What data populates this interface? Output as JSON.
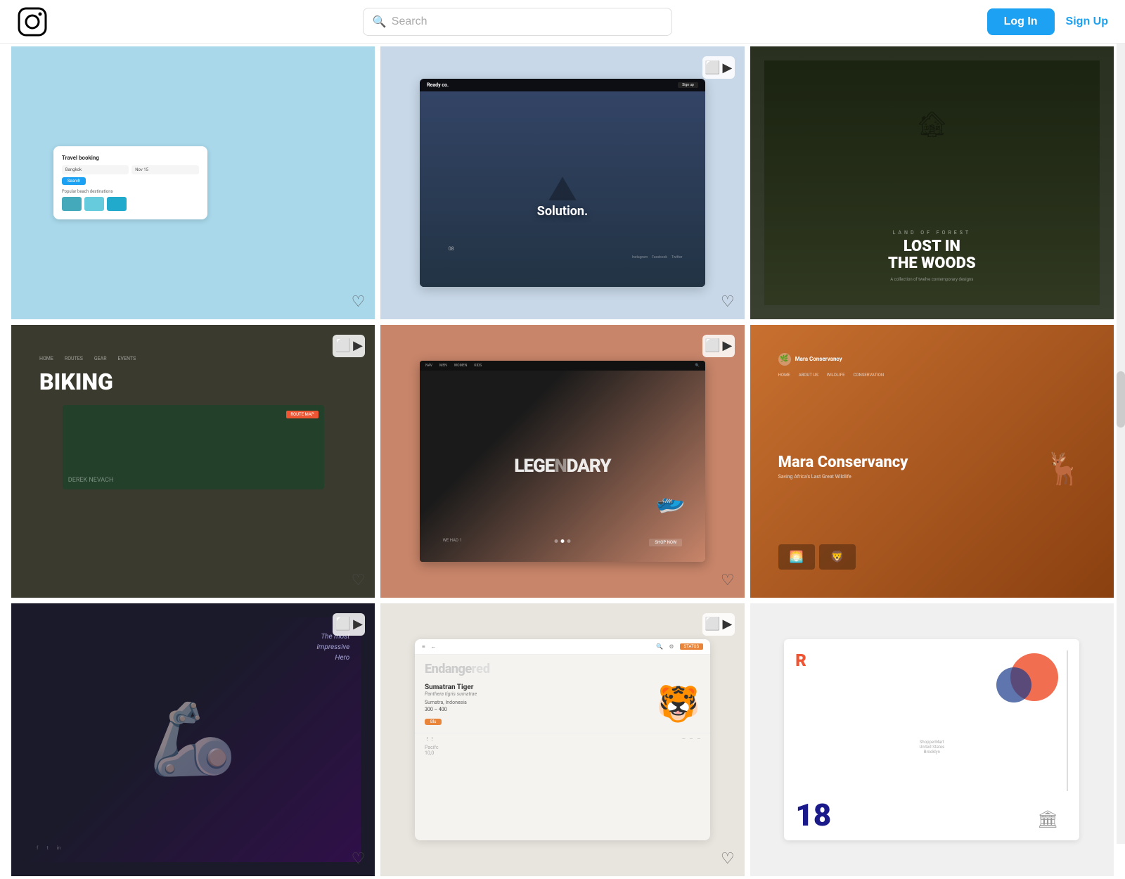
{
  "header": {
    "logo_alt": "Instagram logo",
    "search_placeholder": "Search",
    "login_label": "Log In",
    "signup_label": "Sign Up"
  },
  "gallery": {
    "items": [
      {
        "id": "travel",
        "type": "photo",
        "card_class": "card-travel",
        "has_heart": true,
        "row": 1,
        "col": 1,
        "alt": "Travel booking UI with beach destinations and teal ocean background"
      },
      {
        "id": "biking",
        "type": "multi",
        "card_class": "card-biking",
        "has_heart": true,
        "row": 1,
        "col": 2,
        "alt": "Biking website design with dark forest aerial view and bold typography"
      },
      {
        "id": "dark-movie",
        "type": "multi",
        "card_class": "card-dark",
        "has_heart": true,
        "row": 1,
        "col": 3,
        "alt": "Dark movie/entertainment website with purple-lit figure"
      },
      {
        "id": "solution",
        "type": "video",
        "card_class": "card-solution",
        "has_heart": true,
        "row": 2,
        "col": 1,
        "alt": "Solution website design with mountain landscape and person silhouette"
      },
      {
        "id": "legendary",
        "type": "video",
        "card_class": "card-legendary",
        "has_heart": true,
        "row": 2,
        "col": 2,
        "alt": "Nike Legendary shoe campaign with dark background on terracotta"
      },
      {
        "id": "endangered",
        "type": "video",
        "card_class": "card-endangered",
        "has_heart": true,
        "row": 2,
        "col": 3,
        "alt": "Endangered species app showing Sumatran Tiger on beige background"
      },
      {
        "id": "woods",
        "type": "photo",
        "card_class": "card-woods",
        "has_heart": false,
        "row": 3,
        "col": 1,
        "alt": "Lost in the Woods dark forest website design"
      },
      {
        "id": "mara",
        "type": "photo",
        "card_class": "card-mara",
        "has_heart": false,
        "row": 3,
        "col": 2,
        "alt": "Mara Conservancy website with orange sunset and wildlife"
      },
      {
        "id": "reddesign",
        "type": "photo",
        "card_class": "card-red",
        "has_heart": false,
        "row": 3,
        "col": 3,
        "alt": "Graphic design layout with red R letter and bold 18 number"
      }
    ]
  }
}
